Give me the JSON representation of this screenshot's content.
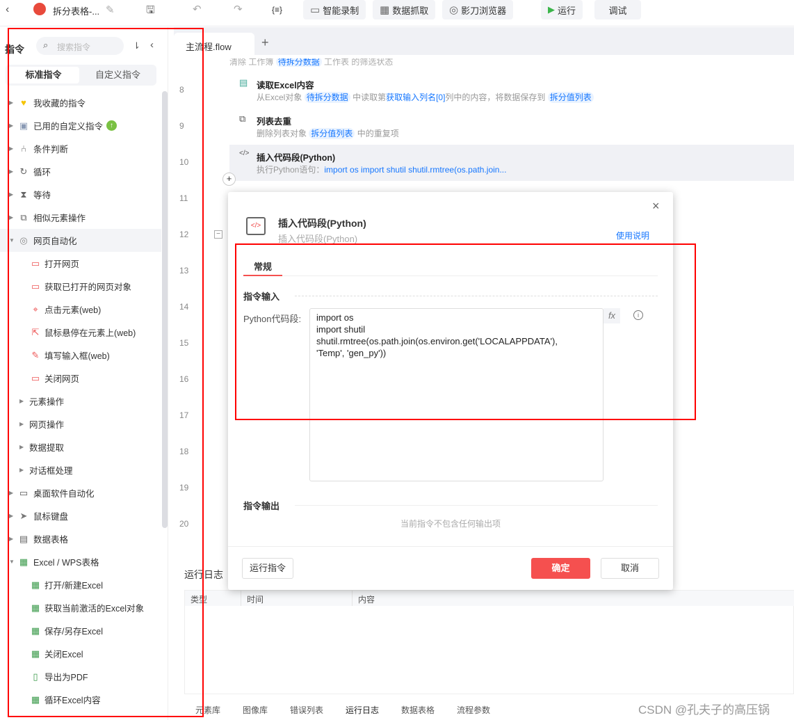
{
  "topbar": {
    "title": "拆分表格-...",
    "buttons": [
      "智能录制",
      "数据抓取",
      "影刀浏览器"
    ],
    "run": "运行",
    "debug": "调试",
    "var_icon": "{≡}"
  },
  "sidebar": {
    "title": "指令",
    "search_placeholder": "搜索指令",
    "tabs": [
      "标准指令",
      "自定义指令"
    ],
    "items": [
      {
        "label": "我收藏的指令",
        "level": 0,
        "icon": "heart-icon"
      },
      {
        "label": "已用的自定义指令",
        "level": 0,
        "icon": "calendar-check-icon"
      },
      {
        "label": "条件判断",
        "level": 0,
        "icon": "branch-icon"
      },
      {
        "label": "循环",
        "level": 0,
        "icon": "loop-icon"
      },
      {
        "label": "等待",
        "level": 0,
        "icon": "hourglass-icon"
      },
      {
        "label": "相似元素操作",
        "level": 0,
        "icon": "copy-icon"
      },
      {
        "label": "网页自动化",
        "level": 0,
        "icon": "chrome-icon",
        "expanded": true
      },
      {
        "label": "打开网页",
        "level": 2,
        "icon": "web-icon"
      },
      {
        "label": "获取已打开的网页对象",
        "level": 2,
        "icon": "web-icon"
      },
      {
        "label": "点击元素(web)",
        "level": 2,
        "icon": "click-icon"
      },
      {
        "label": "鼠标悬停在元素上(web)",
        "level": 2,
        "icon": "hover-icon"
      },
      {
        "label": "填写输入框(web)",
        "level": 2,
        "icon": "input-icon"
      },
      {
        "label": "关闭网页",
        "level": 2,
        "icon": "web-icon"
      },
      {
        "label": "元素操作",
        "level": 1
      },
      {
        "label": "网页操作",
        "level": 1
      },
      {
        "label": "数据提取",
        "level": 1
      },
      {
        "label": "对话框处理",
        "level": 1
      },
      {
        "label": "桌面软件自动化",
        "level": 0,
        "icon": "monitor-icon"
      },
      {
        "label": "鼠标键盘",
        "level": 0,
        "icon": "cursor-icon"
      },
      {
        "label": "数据表格",
        "level": 0,
        "icon": "table-icon"
      },
      {
        "label": "Excel / WPS表格",
        "level": 0,
        "icon": "excel-icon",
        "expanded": true
      },
      {
        "label": "打开/新建Excel",
        "level": 2,
        "icon": "excel-icon"
      },
      {
        "label": "获取当前激活的Excel对象",
        "level": 2,
        "icon": "excel-icon"
      },
      {
        "label": "保存/另存Excel",
        "level": 2,
        "icon": "excel-icon"
      },
      {
        "label": "关闭Excel",
        "level": 2,
        "icon": "excel-icon"
      },
      {
        "label": "导出为PDF",
        "level": 2,
        "icon": "pdf-icon"
      },
      {
        "label": "循环Excel内容",
        "level": 2,
        "icon": "excel-icon"
      }
    ]
  },
  "editor": {
    "tab": "主流程.flow",
    "line_numbers": [
      "8",
      "9",
      "10",
      "11",
      "12",
      "13",
      "14",
      "15",
      "16",
      "17",
      "18",
      "19",
      "20"
    ],
    "partial_step": {
      "a": "清除 工作簿",
      "t1": "待拆分数据",
      "b": "工作表 的筛选状态"
    },
    "steps": [
      {
        "title": "读取Excel内容",
        "p1": "从Excel对象",
        "tag1": "待拆分数据",
        "p2": "中读取第",
        "var": "获取输入列名[0]",
        "p3": "列中的内容，将数据保存到",
        "tag2": "拆分值列表"
      },
      {
        "title": "列表去重",
        "p1": "删除列表对象",
        "tag1": "拆分值列表",
        "p2": "中的重复项"
      },
      {
        "title": "插入代码段(Python)",
        "p1": "执行Python语句：",
        "code": "import os import shutil shutil.rmtree(os.path.join..."
      }
    ]
  },
  "dialog": {
    "title": "插入代码段(Python)",
    "subtitle": "插入代码段(Python)",
    "help": "使用说明",
    "tab": "常规",
    "input_section": "指令输入",
    "field_label": "Python代码段:",
    "code": "import os\nimport shutil\nshutil.rmtree(os.path.join(os.environ.get('LOCALAPPDATA'),\n'Temp', 'gen_py'))",
    "fx": "fx",
    "output_section": "指令输出",
    "no_output": "当前指令不包含任何输出项",
    "run_btn": "运行指令",
    "ok": "确定",
    "cancel": "取消"
  },
  "log": {
    "title": "运行日志",
    "columns": [
      "类型",
      "时间",
      "内容"
    ]
  },
  "bottom_tabs": [
    "元素库",
    "图像库",
    "错误列表",
    "运行日志",
    "数据表格",
    "流程参数"
  ],
  "watermark": "CSDN @孔夫子的高压锅",
  "colors": {
    "accent": "#1677ff",
    "primary_button": "#f5504f",
    "annotation": "#ff0000"
  }
}
